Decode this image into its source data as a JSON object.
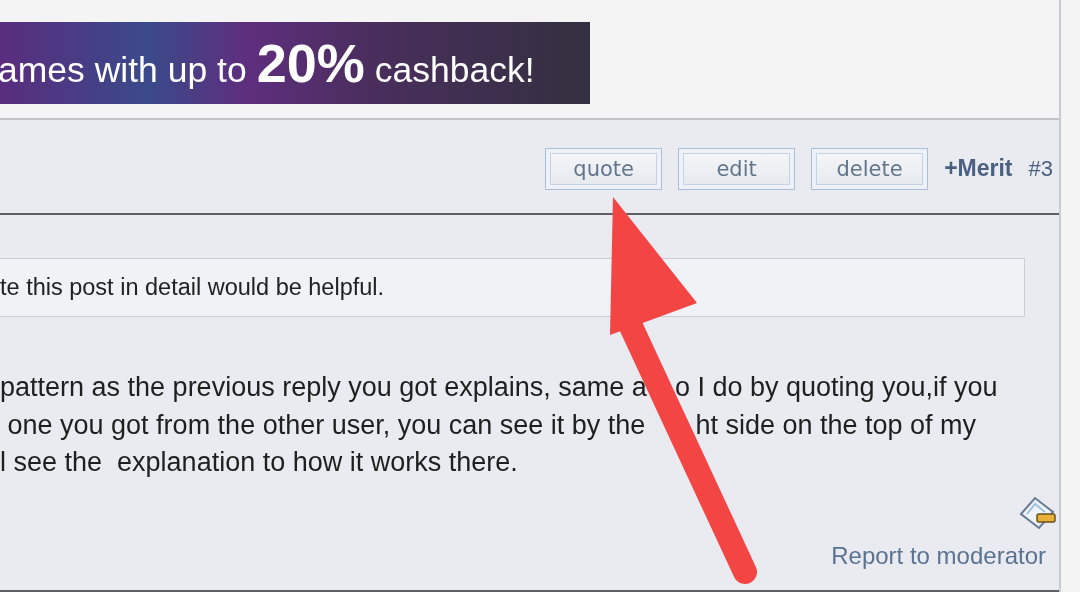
{
  "banner": {
    "text_before": "ames with up to",
    "highlight": "20%",
    "text_after": "cashback!"
  },
  "post": {
    "buttons": [
      {
        "label": "quote"
      },
      {
        "label": "edit"
      },
      {
        "label": "delete"
      }
    ],
    "merit": "+Merit",
    "number": "#3",
    "quote": "te this post in detail would be helpful.",
    "body": [
      [
        "pattern as the previous reply you got explains, same a",
        "o I do by quoting you,if you"
      ],
      [
        " one you got from the other user, you can see it by the",
        "ht side on the top of my"
      ],
      [
        "l see the  explanation to how it works there."
      ]
    ],
    "report": "Report to moderator"
  },
  "annotation": {
    "kind": "arrow"
  }
}
